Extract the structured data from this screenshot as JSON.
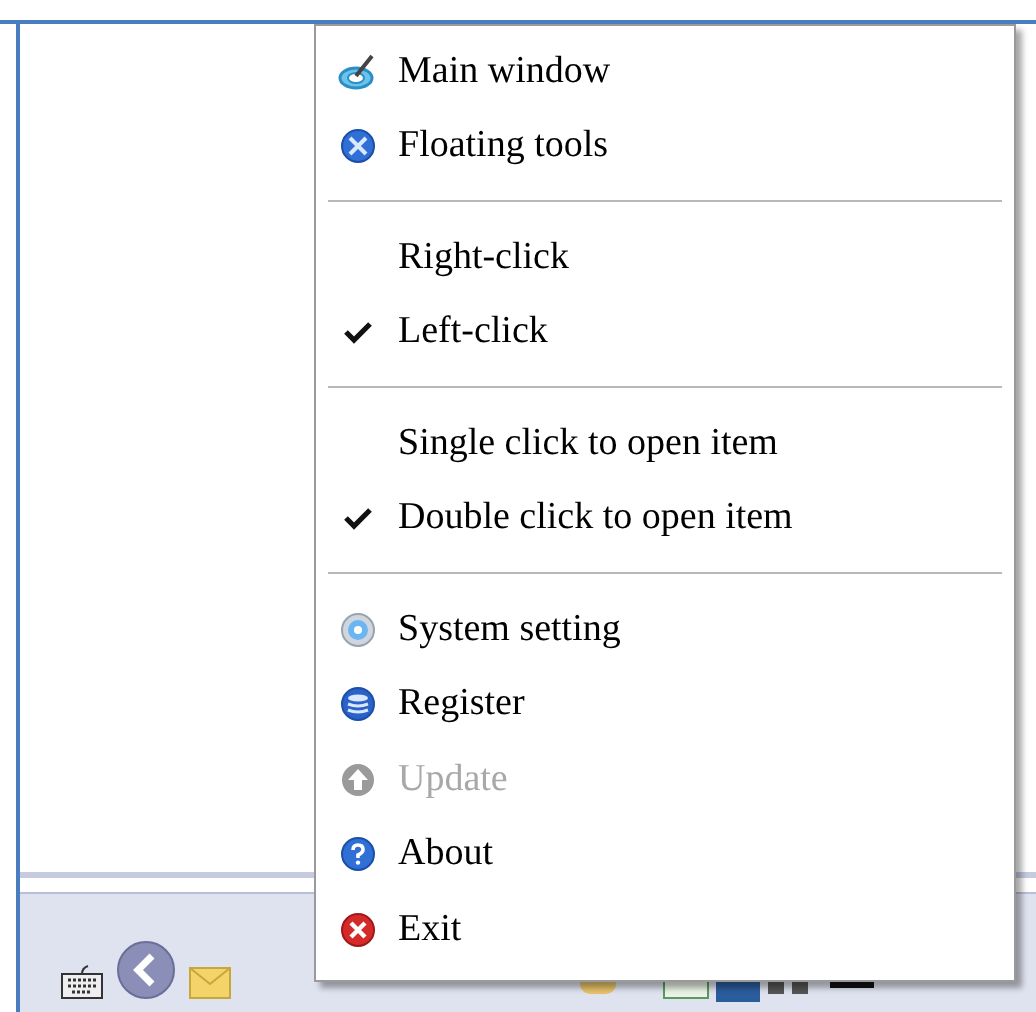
{
  "menu": {
    "sections": [
      {
        "items": [
          {
            "label": "Main window",
            "kind": "icon",
            "disabled": false
          },
          {
            "label": "Floating tools",
            "kind": "icon",
            "disabled": false
          }
        ]
      },
      {
        "items": [
          {
            "label": "Right-click",
            "kind": "option",
            "checked": false
          },
          {
            "label": "Left-click",
            "kind": "option",
            "checked": true
          }
        ]
      },
      {
        "items": [
          {
            "label": "Single click to open item",
            "kind": "option",
            "checked": false
          },
          {
            "label": "Double click to open item",
            "kind": "option",
            "checked": true
          }
        ]
      },
      {
        "items": [
          {
            "label": "System setting",
            "kind": "icon",
            "disabled": false
          },
          {
            "label": "Register",
            "kind": "icon",
            "disabled": false
          },
          {
            "label": "Update",
            "kind": "icon",
            "disabled": true
          },
          {
            "label": "About",
            "kind": "icon",
            "disabled": false
          },
          {
            "label": "Exit",
            "kind": "icon",
            "disabled": false
          }
        ]
      }
    ]
  }
}
